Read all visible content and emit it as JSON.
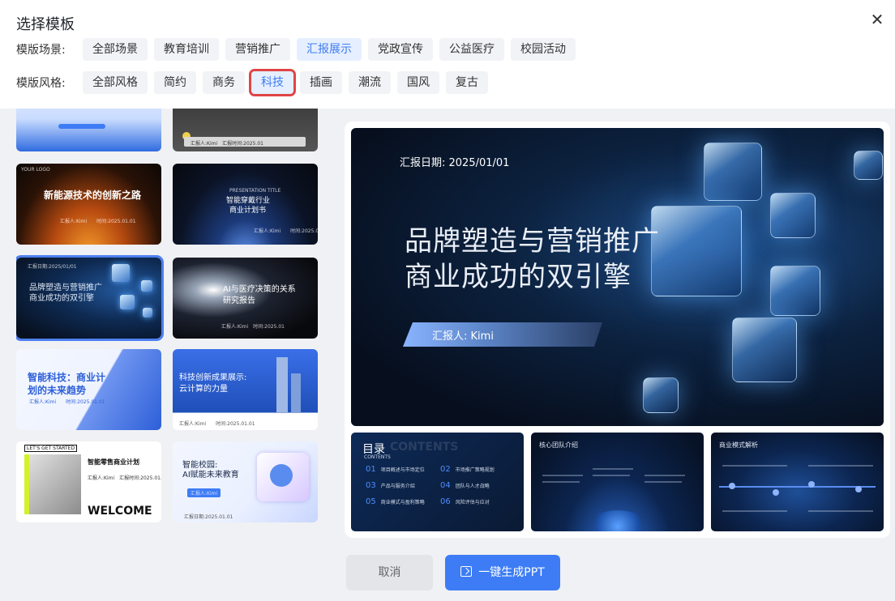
{
  "dialog": {
    "title": "选择模板",
    "close_icon": "close-icon"
  },
  "filters": {
    "scene": {
      "label": "模版场景:",
      "options": [
        "全部场景",
        "教育培训",
        "营销推广",
        "汇报展示",
        "党政宣传",
        "公益医疗",
        "校园活动"
      ],
      "selected": "汇报展示"
    },
    "style": {
      "label": "模版风格:",
      "options": [
        "全部风格",
        "简约",
        "商务",
        "科技",
        "插画",
        "潮流",
        "国风",
        "复古"
      ],
      "selected": "科技"
    }
  },
  "templates": [
    {
      "title": "新能源技术的创新之路",
      "corner": "YOUR LOGO",
      "meta": "汇报人:Kimi　　时间:2025.01.01"
    },
    {
      "title": "智能穿戴行业",
      "title2": "商业计划书",
      "corner": "PRESENTATION TITLE",
      "meta": "汇报人:Kimi　　时间:2025.01"
    },
    {
      "title": "品牌塑造与营销推广",
      "title2": "商业成功的双引擎",
      "corner": "汇报日期:2025/01/01",
      "selected": true
    },
    {
      "title": "AI与医疗决策的关系",
      "title2": "研究报告",
      "meta": "汇报人:Kimi　时间:2025.01"
    },
    {
      "title": "智能科技：商业计",
      "title2": "划的未来趋势",
      "meta": "汇报人:Kimi　　时间:2025.01.01"
    },
    {
      "title": "科技创新成果展示:",
      "title2": "云计算的力量",
      "meta": "汇报人:Kimi　　时间:2025.01.01"
    },
    {
      "title": "智能零售商业计划",
      "corner": "LET'S GET STARTED",
      "meta": "汇报人:Kimi　汇报时间:2025.01.01",
      "footer": "WELCOME"
    },
    {
      "title": "智能校园:",
      "title2": "AI赋能未来教育",
      "meta": "汇报人:Kimi",
      "footer": "汇报日期:2025.01.01"
    },
    {
      "meta": "汇报人:Kimi　汇报时间:2025.01"
    }
  ],
  "preview": {
    "date": "汇报日期: 2025/01/01",
    "title_line1": "品牌塑造与营销推广",
    "title_line2": "商业成功的双引擎",
    "reporter": "汇报人: Kimi",
    "toc": {
      "title": "目录",
      "ghost": "CONTENTS",
      "subtitle": "CONTENTS",
      "items": [
        {
          "num": "01",
          "text": "项目概述与市场定位"
        },
        {
          "num": "02",
          "text": "市场推广策略规划"
        },
        {
          "num": "03",
          "text": "产品与服务介绍"
        },
        {
          "num": "04",
          "text": "团队与人才战略"
        },
        {
          "num": "05",
          "text": "商业模式与盈利策略"
        },
        {
          "num": "06",
          "text": "风险评估与应对"
        }
      ]
    },
    "team_slide": {
      "title": "核心团队介绍"
    },
    "business_slide": {
      "title": "商业模式解析"
    }
  },
  "actions": {
    "cancel": "取消",
    "generate": "一键生成PPT"
  },
  "colors": {
    "accent": "#3d7cf5",
    "highlight_box": "#e04545",
    "chip_active_bg": "#e5efff"
  }
}
